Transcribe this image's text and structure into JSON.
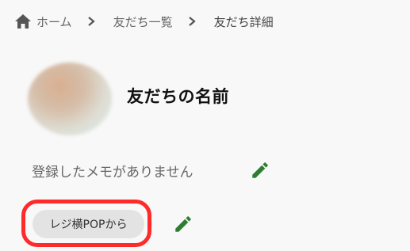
{
  "breadcrumb": {
    "home": "ホーム",
    "friends_list": "友だち一覧",
    "current": "友だち詳細"
  },
  "profile": {
    "name": "友だちの名前",
    "memo_placeholder": "登録したメモがありません",
    "source_tag": "レジ横POPから"
  },
  "icons": {
    "home": "home-icon",
    "separator": "chevron-right-icon",
    "edit": "pencil-icon"
  },
  "colors": {
    "edit_icon": "#2e7d32",
    "highlight": "#ff2a2a",
    "tag_background": "#e3e3e3"
  }
}
